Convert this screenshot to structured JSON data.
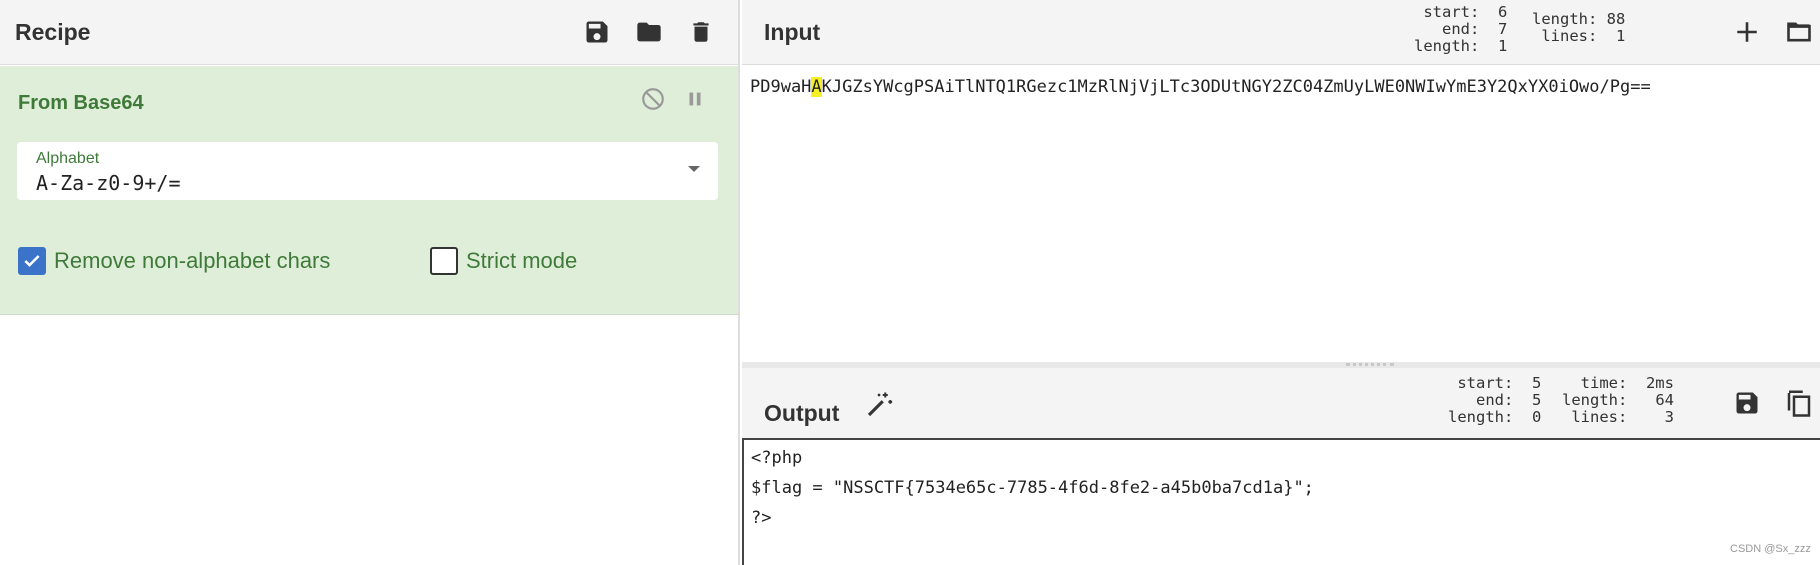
{
  "recipe": {
    "title": "Recipe",
    "icons": [
      "save-icon",
      "folder-icon",
      "trash-icon"
    ],
    "operation": {
      "name": "From Base64",
      "alphabet_label": "Alphabet",
      "alphabet_value": "A-Za-z0-9+/=",
      "remove_non_alphabet": {
        "label": "Remove non-alphabet chars",
        "checked": true
      },
      "strict_mode": {
        "label": "Strict mode",
        "checked": false
      }
    }
  },
  "input": {
    "title": "Input",
    "stats_left": "start:  6\nend:  7\nlength:  1",
    "stats_right": "length: 88\nlines:  1",
    "text_before": "PD9waH",
    "text_selected": "A",
    "text_after": "KJGZsYWcgPSAiTlNTQ1RGezc1MzRlNjVjLTc3ODUtNGY2ZC04ZmUyLWE0NWIwYmE3Y2QxYX0iOwo/Pg=="
  },
  "output": {
    "title": "Output",
    "stats_left": "start:  5\nend:  5\nlength:  0",
    "stats_right": "time:  2ms\nlength:   64\nlines:    3",
    "lines": [
      "<?php",
      "$flag = \"NSSCTF{7534e65c-7785-4f6d-8fe2-a45b0ba7cd1a}\";",
      "?>"
    ]
  },
  "watermark": "CSDN @Sx_zzz",
  "colors": {
    "operation_bg": "#dfeed8",
    "operation_text": "#3f7a3a",
    "checkbox": "#3b73c9",
    "highlight": "#f5f026"
  }
}
